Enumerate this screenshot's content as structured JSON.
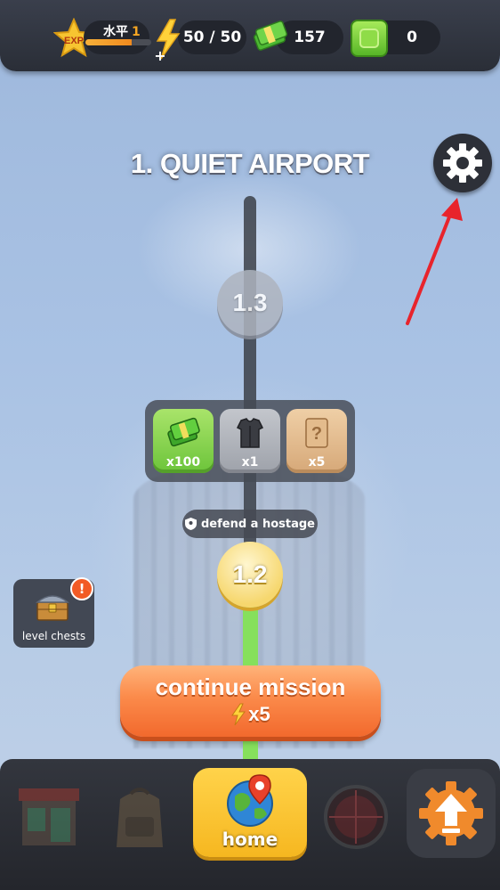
{
  "hud": {
    "exp_badge": "EXP",
    "level_label": "水平",
    "level_value": "1",
    "xp_progress": 0.7,
    "energy": "50 / 50",
    "cash": "157",
    "gems": "0"
  },
  "map": {
    "level_title": "1. QUIET AIRPORT",
    "nodes": [
      "1.3",
      "1.2"
    ],
    "rewards": [
      {
        "icon": "cash-stack-icon",
        "amount": "x100"
      },
      {
        "icon": "armor-vest-icon",
        "amount": "x1"
      },
      {
        "icon": "mystery-card-icon",
        "amount": "x5"
      }
    ],
    "objective": "defend a hostage",
    "level_chests_label": "level chests",
    "chest_badge": "!"
  },
  "continue": {
    "label": "continue mission",
    "cost": "x5"
  },
  "nav": {
    "home_label": "home"
  },
  "colors": {
    "accent_orange": "#f2692d",
    "home_yellow": "#f6b720",
    "progress_green": "#86e05c",
    "annotation_red": "#e8242c"
  }
}
